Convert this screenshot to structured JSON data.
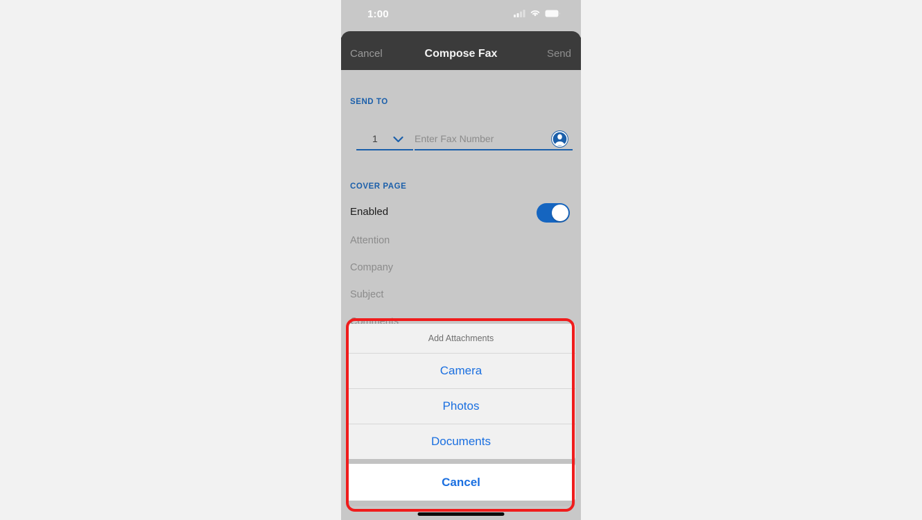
{
  "status_bar": {
    "time": "1:00",
    "icons": [
      "cellular-signal-icon",
      "wifi-icon",
      "battery-icon"
    ]
  },
  "navbar": {
    "cancel_label": "Cancel",
    "title": "Compose Fax",
    "send_label": "Send"
  },
  "form": {
    "send_to_header": "SEND TO",
    "recipient_count": "1",
    "recipient_count_chevron": "chevron-down-icon",
    "fax_placeholder": "Enter Fax Number",
    "contact_icon": "contact-avatar-icon",
    "cover_page_header": "COVER PAGE",
    "enabled_label": "Enabled",
    "enabled_state": "on",
    "fields": [
      {
        "placeholder": "Attention",
        "value": ""
      },
      {
        "placeholder": "Company",
        "value": ""
      },
      {
        "placeholder": "Subject",
        "value": ""
      },
      {
        "placeholder": "Comments",
        "value": ""
      }
    ]
  },
  "action_sheet": {
    "title": "Add Attachments",
    "options": [
      {
        "label": "Camera"
      },
      {
        "label": "Photos"
      },
      {
        "label": "Documents"
      }
    ],
    "cancel_label": "Cancel"
  },
  "annotation": {
    "shape": "rounded-rectangle-highlight",
    "color": "#ef1c1c"
  },
  "colors": {
    "accent_blue": "#1a6fe0",
    "header_blue": "#1b5faa",
    "toggle_on": "#1565c0",
    "navbar_dark": "#3b3b3b",
    "screen_gray": "#c8c8c8",
    "page_background": "#f2f2f2"
  }
}
